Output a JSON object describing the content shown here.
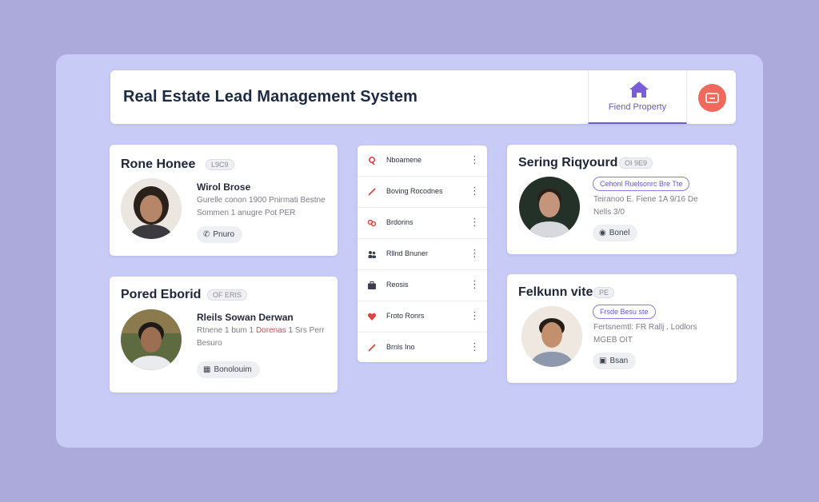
{
  "app": {
    "title": "Real Estate Lead Management System",
    "tab_label": "Fiend Property"
  },
  "colors": {
    "background": "#abaadb",
    "panel": "#c8cbf6",
    "accent": "#6f58d9",
    "action": "#ef6a5d"
  },
  "cards": [
    {
      "name": "Rone Honee",
      "tag": "L9C9",
      "role": "Wirol Brose",
      "details": [
        "Gurelle conon 1900 Pnirmati Bestne",
        "Sommen 1 anugre Pot PER"
      ],
      "pill_icon": "phone-icon",
      "pill_label": "Pnuro"
    },
    {
      "name": "Pored Eborid",
      "tag": "OF ERIS",
      "role": "Rleils Sowan Derwan",
      "details_prefix": "Rtnene 1 bum 1",
      "details_warm": "Dorenas 1",
      "details_suffix": "Srs Perr",
      "details_line2": "Besuro",
      "pill_icon": "grid-icon",
      "pill_label": "Bonolouim"
    },
    {
      "name": "Sering Riqyourd",
      "tag": "OI 9E9",
      "outline_label": "Cehonl Ruelsonrc Bre Tte",
      "details": [
        "Teiranoo E. Fiene 1A 9/16 De",
        "Nells 3/0"
      ],
      "pill_icon": "car-icon",
      "pill_label": "Bonel"
    },
    {
      "name": "Felkunn vite",
      "tag": "PE",
      "outline_label": "Frsde Besu ste",
      "details": [
        "Fertsnemtl: FR Rallj . Lodlors",
        "MGEB OIT"
      ],
      "pill_icon": "tray-icon",
      "pill_label": "Bsan"
    }
  ],
  "list": [
    {
      "label": "Nboamene",
      "icon": "pin-icon"
    },
    {
      "label": "Boving Rocodnes",
      "icon": "pencil-icon"
    },
    {
      "label": "Brdorins",
      "icon": "link-icon"
    },
    {
      "label": "Rllnd Bnuner",
      "icon": "people-icon"
    },
    {
      "label": "Reosis",
      "icon": "briefcase-icon"
    },
    {
      "label": "Froto Ronrs",
      "icon": "heart-icon"
    },
    {
      "label": "Brnls Ino",
      "icon": "pencil-icon"
    }
  ]
}
